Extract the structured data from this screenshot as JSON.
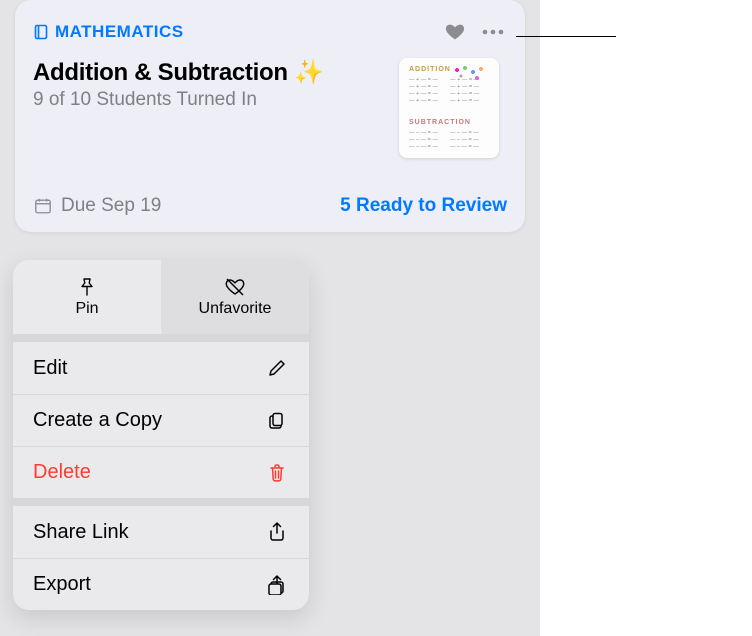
{
  "card": {
    "subject_label": "MATHEMATICS",
    "title": "Addition & Subtraction ✨",
    "subtitle": "9 of 10 Students Turned In",
    "due_label": "Due Sep 19",
    "review_label": "5 Ready to Review",
    "thumb": {
      "heading1": "ADDITION",
      "heading2": "SUBTRACTION"
    }
  },
  "menu": {
    "header": [
      {
        "label": "Pin",
        "icon": "pin-icon"
      },
      {
        "label": "Unfavorite",
        "icon": "heart-slash-icon",
        "selected": true
      }
    ],
    "groups": [
      [
        {
          "label": "Edit",
          "icon": "pencil-icon"
        },
        {
          "label": "Create a Copy",
          "icon": "copy-icon"
        },
        {
          "label": "Delete",
          "icon": "trash-icon",
          "destructive": true
        }
      ],
      [
        {
          "label": "Share Link",
          "icon": "share-icon"
        },
        {
          "label": "Export",
          "icon": "export-icon"
        }
      ]
    ]
  }
}
